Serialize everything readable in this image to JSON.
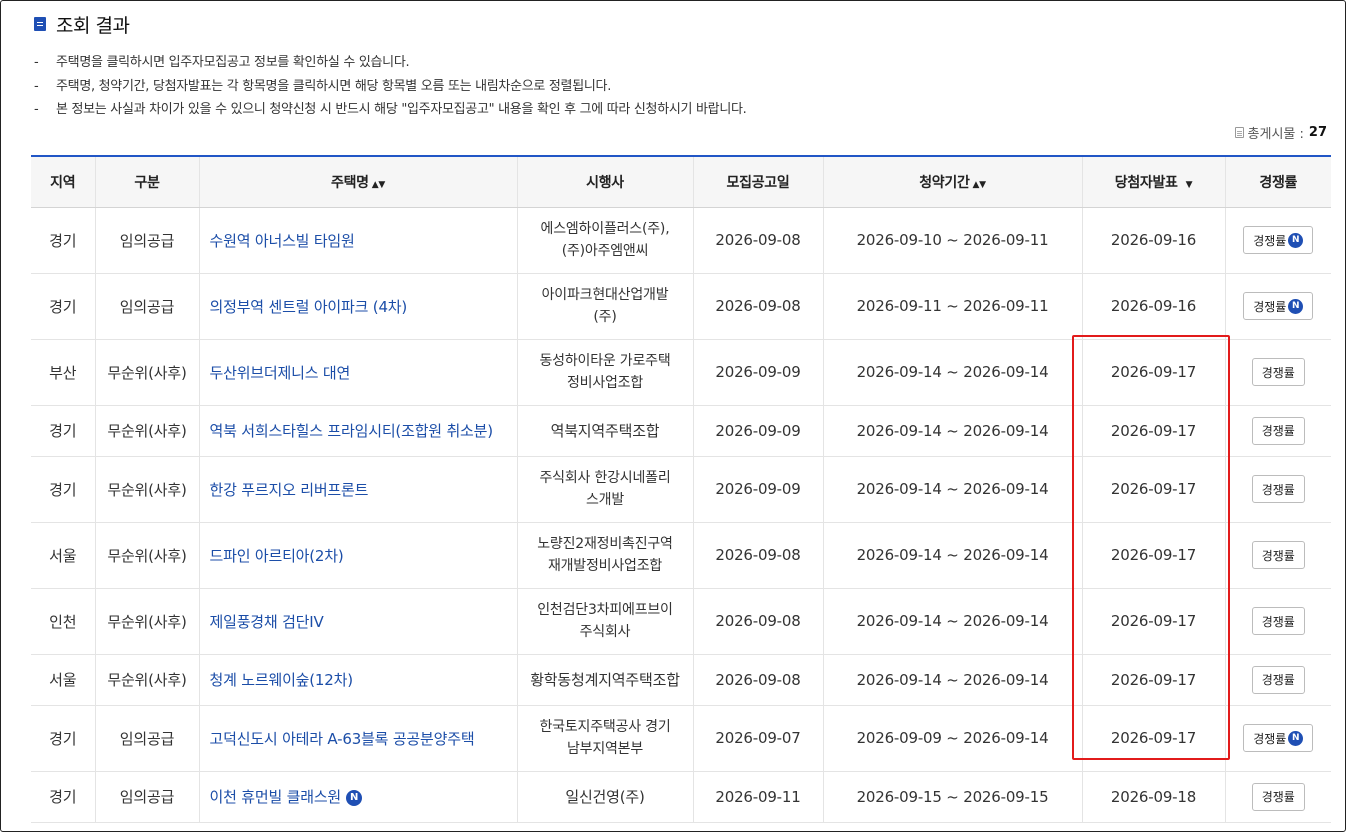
{
  "header": {
    "title": "조회 결과",
    "title_icon": "document-icon",
    "accent_color": "#1f4fb4"
  },
  "notes": [
    "주택명을 클릭하시면 입주자모집공고 정보를 확인하실 수 있습니다.",
    "주택명, 청약기간, 당첨자발표는 각 항목명을 클릭하시면 해당 항목별 오름 또는 내림차순으로 정렬됩니다.",
    "본 정보는 사실과 차이가 있을 수 있으니 청약신청 시 반드시 해당 \"입주자모집공고\" 내용을 확인 후 그에 따라 신청하시기 바랍니다."
  ],
  "total": {
    "label": "총게시물 :",
    "count": "27"
  },
  "table": {
    "headers": {
      "region": "지역",
      "type": "구분",
      "house": "주택명",
      "developer": "시행사",
      "notice_date": "모집공고일",
      "period": "청약기간",
      "winner_date": "당첨자발표",
      "rate": "경쟁률"
    },
    "sort_icons": {
      "house": "▲▼",
      "period": "▲▼",
      "winner_date": "▼"
    },
    "rate_label": "경쟁률",
    "new_badge": "N",
    "rows": [
      {
        "region": "경기",
        "type": "임의공급",
        "house": "수원역 아너스빌 타임원",
        "developer": "에스엠하이플러스(주),\n(주)아주엠앤씨",
        "notice_date": "2026-09-08",
        "period": "2026-09-10 ~ 2026-09-11",
        "winner_date": "2026-09-16"
      },
      {
        "region": "경기",
        "type": "임의공급",
        "house": "의정부역 센트럴 아이파크 (4차)",
        "developer": "아이파크현대산업개발\n(주)",
        "notice_date": "2026-09-08",
        "period": "2026-09-11 ~ 2026-09-11",
        "winner_date": "2026-09-16"
      },
      {
        "region": "부산",
        "type": "무순위(사후)",
        "house": "두산위브더제니스 대연",
        "developer": "동성하이타운 가로주택\n정비사업조합",
        "notice_date": "2026-09-09",
        "period": "2026-09-14 ~ 2026-09-14",
        "winner_date": "2026-09-17"
      },
      {
        "region": "경기",
        "type": "무순위(사후)",
        "house": "역북 서희스타힐스 프라임시티(조합원 취소분)",
        "developer": "역북지역주택조합",
        "notice_date": "2026-09-09",
        "period": "2026-09-14 ~ 2026-09-14",
        "winner_date": "2026-09-17"
      },
      {
        "region": "경기",
        "type": "무순위(사후)",
        "house": "한강 푸르지오 리버프론트",
        "developer": "주식회사 한강시네폴리\n스개발",
        "notice_date": "2026-09-09",
        "period": "2026-09-14 ~ 2026-09-14",
        "winner_date": "2026-09-17"
      },
      {
        "region": "서울",
        "type": "무순위(사후)",
        "house": "드파인 아르티아(2차)",
        "developer": "노량진2재정비촉진구역\n재개발정비사업조합",
        "notice_date": "2026-09-08",
        "period": "2026-09-14 ~ 2026-09-14",
        "winner_date": "2026-09-17"
      },
      {
        "region": "인천",
        "type": "무순위(사후)",
        "house": "제일풍경채 검단IV",
        "developer": "인천검단3차피에프브이\n주식회사",
        "notice_date": "2026-09-08",
        "period": "2026-09-14 ~ 2026-09-14",
        "winner_date": "2026-09-17"
      },
      {
        "region": "서울",
        "type": "무순위(사후)",
        "house": "청계 노르웨이숲(12차)",
        "developer": "황학동청계지역주택조합",
        "notice_date": "2026-09-08",
        "period": "2026-09-14 ~ 2026-09-14",
        "winner_date": "2026-09-17"
      },
      {
        "region": "경기",
        "type": "임의공급",
        "house": "고덕신도시 아테라 A-63블록 공공분양주택",
        "developer": "한국토지주택공사 경기\n남부지역본부",
        "notice_date": "2026-09-07",
        "period": "2026-09-09 ~ 2026-09-14",
        "winner_date": "2026-09-17"
      },
      {
        "region": "경기",
        "type": "임의공급",
        "house": "이천 휴먼빌 클래스원",
        "developer": "일신건영(주)",
        "notice_date": "2026-09-11",
        "period": "2026-09-15 ~ 2026-09-15",
        "winner_date": "2026-09-18"
      }
    ]
  },
  "highlight_color": "#e21b1b"
}
